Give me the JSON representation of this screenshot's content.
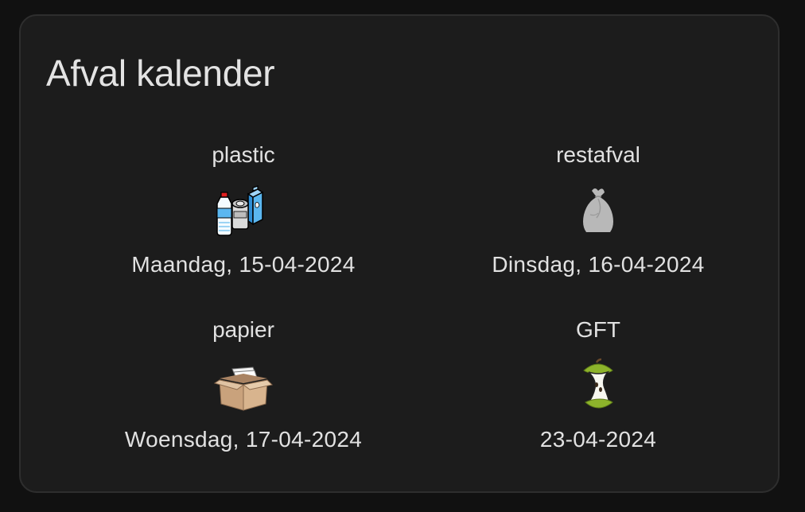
{
  "card": {
    "title": "Afval kalender"
  },
  "items": [
    {
      "name": "plastic",
      "date": "Maandag, 15-04-2024",
      "icon": "plastic-bottles-cans-carton-icon"
    },
    {
      "name": "restafval",
      "date": "Dinsdag, 16-04-2024",
      "icon": "garbage-bag-icon"
    },
    {
      "name": "papier",
      "date": "Woensdag, 17-04-2024",
      "icon": "cardboard-box-icon"
    },
    {
      "name": "GFT",
      "date": "23-04-2024",
      "icon": "apple-core-icon"
    }
  ],
  "colors": {
    "background": "#111111",
    "card": "#1c1c1c",
    "text": "#e1e1e1",
    "gft_green": "#8db32b",
    "box_brown": "#c9a27c",
    "bag_gray": "#b8b8b8",
    "plastic_blue": "#4aa8e8"
  }
}
